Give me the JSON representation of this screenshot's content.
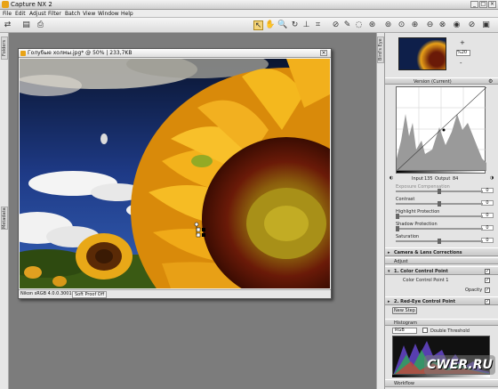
{
  "app": {
    "title": "Capture NX 2",
    "window_controls": [
      "_",
      "□",
      "×"
    ]
  },
  "menu": [
    "File",
    "Edit",
    "Adjust",
    "Filter",
    "Batch",
    "View",
    "Window",
    "Help"
  ],
  "left_tabs": {
    "top": "Folders",
    "bottom": "Metadata"
  },
  "image_window": {
    "title": "Голубые холмы.jpg* @ 50% | 233,7KB",
    "status_profile": "Nikon sRGB 4.0.0.3001",
    "status_softproof": "Soft Proof Off"
  },
  "right_tab": "Bird's Eye",
  "birdseye": {
    "zoom_value": "%20",
    "zoom_in": "+",
    "zoom_out": "-"
  },
  "curves": {
    "version_label": "Version",
    "version_value": "(Current)",
    "input_label": "Input",
    "input_value": "135",
    "output_label": "Output",
    "output_value": "84"
  },
  "adjust_rows": [
    {
      "label": "Exposure Compensation",
      "value": "0"
    },
    {
      "label": "Contrast",
      "value": "0"
    },
    {
      "label": "Highlight Protection",
      "value": "0"
    },
    {
      "label": "Shadow Protection",
      "value": "0"
    },
    {
      "label": "Saturation",
      "value": "0"
    }
  ],
  "sections": {
    "camera": "Camera & Lens Corrections",
    "adjust": "Adjust",
    "ccp": "1. Color Control Point",
    "ccp_item": "Color Control Point 1",
    "opacity": "Opacity",
    "redeye": "2. Red-Eye Control Point",
    "new_step": "New Step",
    "histogram": "Histogram",
    "hist_channel": "RGB",
    "double_threshold": "Double Threshold",
    "workflow": "Workflow"
  },
  "watermark": "CWER.RU",
  "colors": {
    "accent": "#f4d47a",
    "workspace": "#7c7c7c"
  }
}
